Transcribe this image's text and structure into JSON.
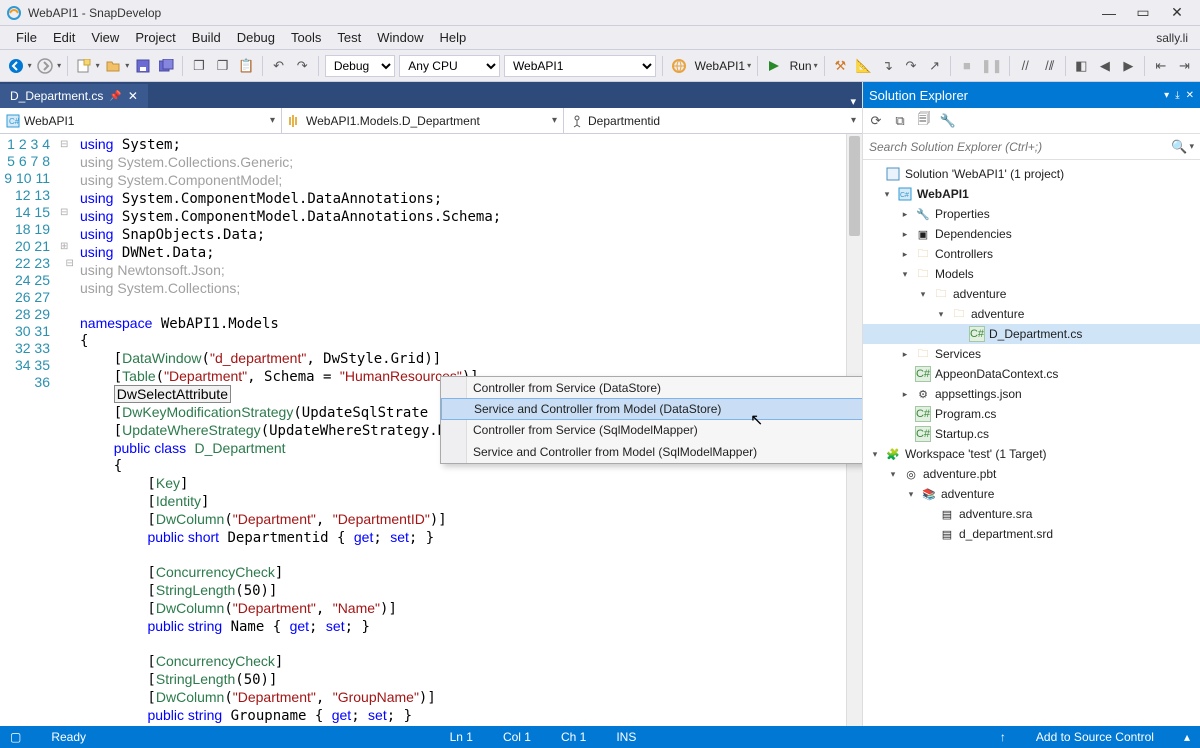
{
  "title_bar": {
    "title": "WebAPI1 - SnapDevelop"
  },
  "menu": {
    "items": [
      "File",
      "Edit",
      "View",
      "Project",
      "Build",
      "Debug",
      "Tools",
      "Test",
      "Window",
      "Help"
    ],
    "user": "sally.li"
  },
  "toolbar": {
    "config": "Debug",
    "platform": "Any CPU",
    "startup": "WebAPI1",
    "target": "WebAPI1",
    "run_label": "Run"
  },
  "editor": {
    "active_tab": "D_Department.cs",
    "nav_dd1": "WebAPI1",
    "nav_dd2": "WebAPI1.Models.D_Department",
    "nav_dd3": "Departmentid",
    "line_numbers": [
      "1",
      "2",
      "3",
      "4",
      "5",
      "6",
      "7",
      "8",
      "9",
      "10",
      "11",
      "12",
      "13",
      "14",
      "15",
      "18",
      "19",
      "20",
      "21",
      "22",
      "23",
      "24",
      "25",
      "26",
      "27",
      "28",
      "29",
      "30",
      "31",
      "32",
      "33",
      "34",
      "35",
      "36"
    ]
  },
  "context_menu": {
    "items": [
      "Controller from Service  (DataStore)",
      "Service and Controller from Model (DataStore)",
      "Controller from Service (SqlModelMapper)",
      "Service and Controller from Model (SqlModelMapper)"
    ]
  },
  "solution_explorer": {
    "title": "Solution Explorer",
    "search_placeholder": "Search Solution Explorer (Ctrl+;)",
    "solution_label": "Solution 'WebAPI1' (1 project)",
    "project": "WebAPI1",
    "nodes": {
      "properties": "Properties",
      "dependencies": "Dependencies",
      "controllers": "Controllers",
      "models": "Models",
      "adventure": "adventure",
      "adventure2": "adventure",
      "d_department": "D_Department.cs",
      "services": "Services",
      "appeon_ctx": "AppeonDataContext.cs",
      "appsettings": "appsettings.json",
      "program": "Program.cs",
      "startup": "Startup.cs",
      "workspace": "Workspace 'test' (1 Target)",
      "adventure_pbt": "adventure.pbt",
      "adventure3": "adventure",
      "adv_sra": "adventure.sra",
      "d_dept_srd": "d_department.srd"
    }
  },
  "status": {
    "ready": "Ready",
    "ln": "Ln 1",
    "col": "Col 1",
    "ch": "Ch 1",
    "ins": "INS",
    "src_ctrl": "Add to Source Control"
  }
}
